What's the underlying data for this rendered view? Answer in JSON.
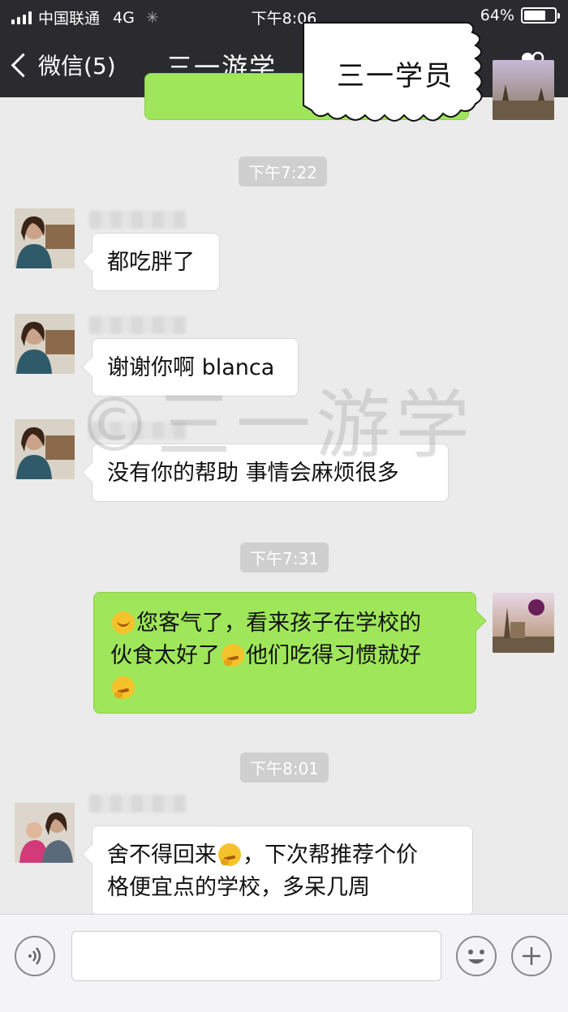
{
  "status_bar": {
    "carrier": "中国联通",
    "network": "4G",
    "time": "下午8:06",
    "battery": "64%",
    "battery_level": 0.64
  },
  "nav": {
    "back_label": "微信(5)",
    "title": "三一游学",
    "group_icon": "group-members-icon"
  },
  "callout": {
    "text": "三一学员"
  },
  "watermark": "©三一游学",
  "messages": {
    "t1": "下午7:22",
    "m1": "都吃胖了",
    "m2": "谢谢你啊 blanca",
    "m3": "没有你的帮助 事情会麻烦很多",
    "t2": "下午7:31",
    "m4_a": "您客气了，看来孩子在学校的",
    "m4_b": "伙食太好了",
    "m4_c": "他们吃得习惯就好",
    "t3": "下午8:01",
    "m5_a": "舍不得回来",
    "m5_b": "，下次帮推荐个价",
    "m5_c": "格便宜点的学校，多呆几周"
  },
  "input_bar": {
    "voice_icon": "voice-icon",
    "emoji_icon": "emoji-icon",
    "plus_icon": "plus-icon",
    "input_value": ""
  },
  "colors": {
    "nav_bg": "#2b2b2f",
    "chat_bg": "#ebebeb",
    "sent_bubble": "#9fe65a",
    "received_bubble": "#ffffff"
  }
}
